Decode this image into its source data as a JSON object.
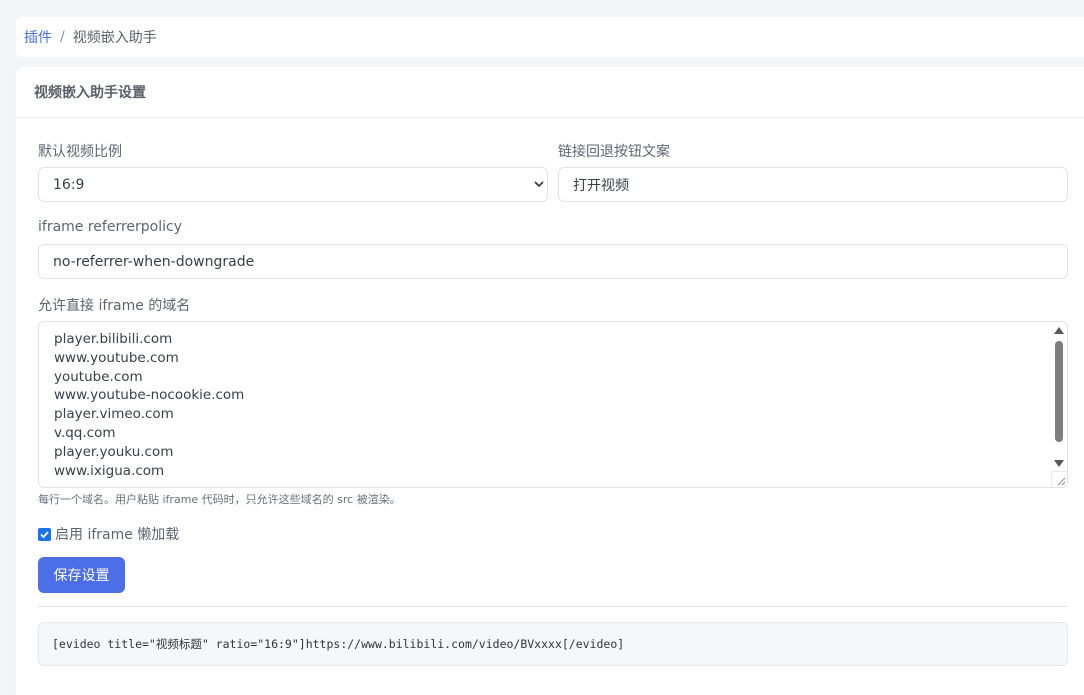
{
  "breadcrumb": {
    "root": "插件",
    "separator": "/",
    "current": "视频嵌入助手"
  },
  "card": {
    "title": "视频嵌入助手设置"
  },
  "form": {
    "ratio_label": "默认视频比例",
    "ratio_value": "16:9",
    "fallback_label": "链接回退按钮文案",
    "fallback_value": "打开视频",
    "referrer_label": "iframe referrerpolicy",
    "referrer_value": "no-referrer-when-downgrade",
    "domains_label": "允许直接 iframe 的域名",
    "domains": [
      "player.bilibili.com",
      "www.youtube.com",
      "youtube.com",
      "www.youtube-nocookie.com",
      "player.vimeo.com",
      "v.qq.com",
      "player.youku.com",
      "www.ixigua.com"
    ],
    "domains_help": "每行一个域名。用户粘贴 iframe 代码时，只允许这些域名的 src 被渲染。",
    "lazy_label": "启用 iframe 懒加载",
    "lazy_checked": true,
    "save_label": "保存设置"
  },
  "example": {
    "shortcode": "[evideo title=\"视频标题\" ratio=\"16:9\"]https://www.bilibili.com/video/BVxxxx[/evideo]"
  },
  "colors": {
    "accent": "#4c6ee6",
    "link": "#4a6fe0"
  }
}
